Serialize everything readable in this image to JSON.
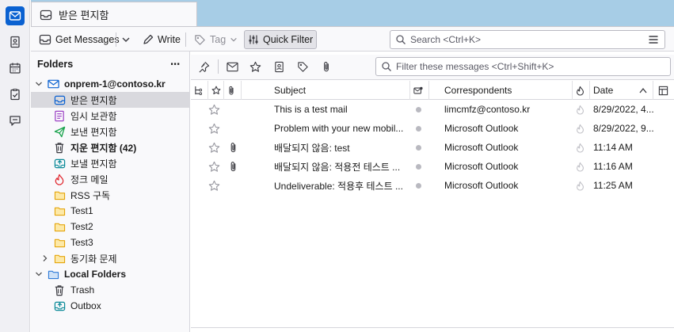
{
  "tab": {
    "title": "받은 편지함"
  },
  "toolbar": {
    "get_messages": "Get Messages",
    "write": "Write",
    "tag": "Tag",
    "quick_filter": "Quick Filter",
    "search_placeholder": "Search <Ctrl+K>"
  },
  "folder_pane": {
    "header": "Folders",
    "account": "onprem-1@contoso.kr",
    "folders": [
      {
        "label": "받은 편지함",
        "icon": "inbox-icon"
      },
      {
        "label": "임시 보관함",
        "icon": "drafts-icon"
      },
      {
        "label": "보낸 편지함",
        "icon": "sent-icon"
      },
      {
        "label": "지운 편지함 (42)",
        "icon": "trash-icon"
      },
      {
        "label": "보낼 편지함",
        "icon": "outbox-icon"
      },
      {
        "label": "정크 메일",
        "icon": "junk-icon"
      },
      {
        "label": "RSS 구독",
        "icon": "folder-icon"
      },
      {
        "label": "Test1",
        "icon": "folder-icon"
      },
      {
        "label": "Test2",
        "icon": "folder-icon"
      },
      {
        "label": "Test3",
        "icon": "folder-icon"
      },
      {
        "label": "동기화 문제",
        "icon": "folder-icon"
      }
    ],
    "local_folders": "Local Folders",
    "local_items": [
      {
        "label": "Trash",
        "icon": "trash-icon"
      },
      {
        "label": "Outbox",
        "icon": "outbox-icon"
      }
    ]
  },
  "message_pane": {
    "filter_placeholder": "Filter these messages <Ctrl+Shift+K>",
    "columns": {
      "subject": "Subject",
      "correspondents": "Correspondents",
      "date": "Date"
    },
    "messages": [
      {
        "subject": "This is a test mail",
        "from": "limcmfz@contoso.kr",
        "date": "8/29/2022, 4...",
        "attachment": false
      },
      {
        "subject": "Problem with your new mobil...",
        "from": "Microsoft Outlook",
        "date": "8/29/2022, 9...",
        "attachment": false
      },
      {
        "subject": "배달되지 않음: test",
        "from": "Microsoft Outlook",
        "date": "11:14 AM",
        "attachment": true
      },
      {
        "subject": "배달되지 않음: 적용전 테스트 ...",
        "from": "Microsoft Outlook",
        "date": "11:16 AM",
        "attachment": true
      },
      {
        "subject": "Undeliverable: 적용후 테스트 ...",
        "from": "Microsoft Outlook",
        "date": "11:25 AM",
        "attachment": false
      }
    ]
  },
  "colors": {
    "accent": "#0a61d1",
    "tab_strip": "#a7cde6",
    "selected_row": "#d9d9de"
  }
}
